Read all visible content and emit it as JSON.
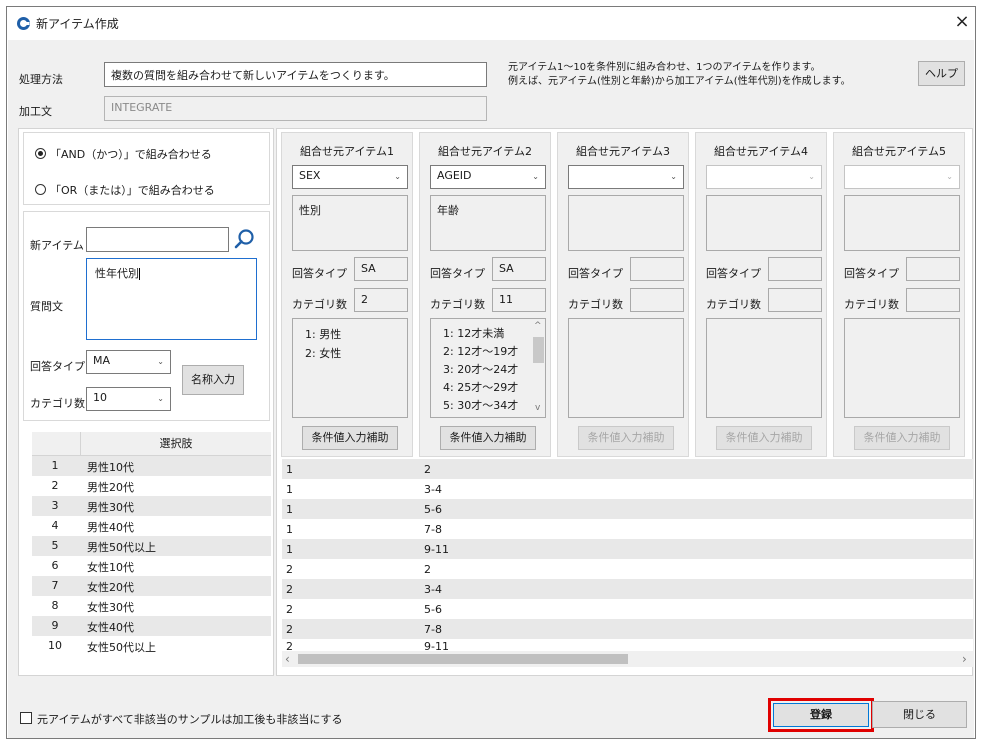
{
  "window": {
    "title": "新アイテム作成",
    "close_glyph": "×"
  },
  "method": {
    "label": "処理方法",
    "value": "複数の質問を組み合わせて新しいアイテムをつくります。",
    "description_1": "元アイテム1～10を条件別に組み合わせ、1つのアイテムを作ります。",
    "description_2": "例えば、元アイテム(性別と年齢)から加工アイテム(性年代別)を作成します。",
    "help_label": "ヘルプ"
  },
  "process": {
    "label": "加工文",
    "value": "INTEGRATE"
  },
  "combine_mode": {
    "and_label": "「AND（かつ）」で組み合わせる",
    "or_label": "「OR（または）」で組み合わせる",
    "selected": "and"
  },
  "new_item": {
    "item_label": "新アイテム",
    "item_value": "",
    "question_label": "質問文",
    "question_value": "性年代別",
    "answer_type_label": "回答タイプ",
    "answer_type_value": "MA",
    "category_count_label": "カテゴリ数",
    "category_count_value": "10",
    "name_input_label": "名称入力"
  },
  "choices": {
    "header": "選択肢",
    "rows": [
      {
        "no": "1",
        "label": "男性10代"
      },
      {
        "no": "2",
        "label": "男性20代"
      },
      {
        "no": "3",
        "label": "男性30代"
      },
      {
        "no": "4",
        "label": "男性40代"
      },
      {
        "no": "5",
        "label": "男性50代以上"
      },
      {
        "no": "6",
        "label": "女性10代"
      },
      {
        "no": "7",
        "label": "女性20代"
      },
      {
        "no": "8",
        "label": "女性30代"
      },
      {
        "no": "9",
        "label": "女性40代"
      },
      {
        "no": "10",
        "label": "女性50代以上"
      }
    ]
  },
  "source_labels": {
    "answer_type": "回答タイプ",
    "category_count": "カテゴリ数",
    "assist_button": "条件値入力補助"
  },
  "sources": [
    {
      "title": "組合せ元アイテム1",
      "item": "SEX",
      "question": "性別",
      "answer_type": "SA",
      "category_count": "2",
      "categories": [
        "1: 男性",
        "2: 女性"
      ],
      "enabled": true
    },
    {
      "title": "組合せ元アイテム2",
      "item": "AGEID",
      "question": "年齢",
      "answer_type": "SA",
      "category_count": "11",
      "categories": [
        "1: 12才未満",
        "2: 12才～19才",
        "3: 20才～24才",
        "4: 25才～29才",
        "5: 30才～34才"
      ],
      "enabled": true
    },
    {
      "title": "組合せ元アイテム3",
      "item": "",
      "question": "",
      "answer_type": "",
      "category_count": "",
      "categories": [],
      "enabled": true
    },
    {
      "title": "組合せ元アイテム4",
      "item": "",
      "question": "",
      "answer_type": "",
      "category_count": "",
      "categories": [],
      "enabled": false
    },
    {
      "title": "組合せ元アイテム5",
      "item": "",
      "question": "",
      "answer_type": "",
      "category_count": "",
      "categories": [],
      "enabled": false
    }
  ],
  "condition_grid": {
    "rows": [
      [
        "1",
        "2"
      ],
      [
        "1",
        "3-4"
      ],
      [
        "1",
        "5-6"
      ],
      [
        "1",
        "7-8"
      ],
      [
        "1",
        "9-11"
      ],
      [
        "2",
        "2"
      ],
      [
        "2",
        "3-4"
      ],
      [
        "2",
        "5-6"
      ],
      [
        "2",
        "7-8"
      ],
      [
        "2",
        "9-11"
      ]
    ],
    "scroll_left": "‹",
    "scroll_right": "›",
    "scroll_up": "^",
    "scroll_down": "v"
  },
  "footer": {
    "checkbox_label": "元アイテムがすべて非該当のサンプルは加工後も非該当にする",
    "register_label": "登録",
    "close_label": "閉じる"
  },
  "colors": {
    "accent": "#1f5fa8",
    "highlight": "#e00000"
  }
}
